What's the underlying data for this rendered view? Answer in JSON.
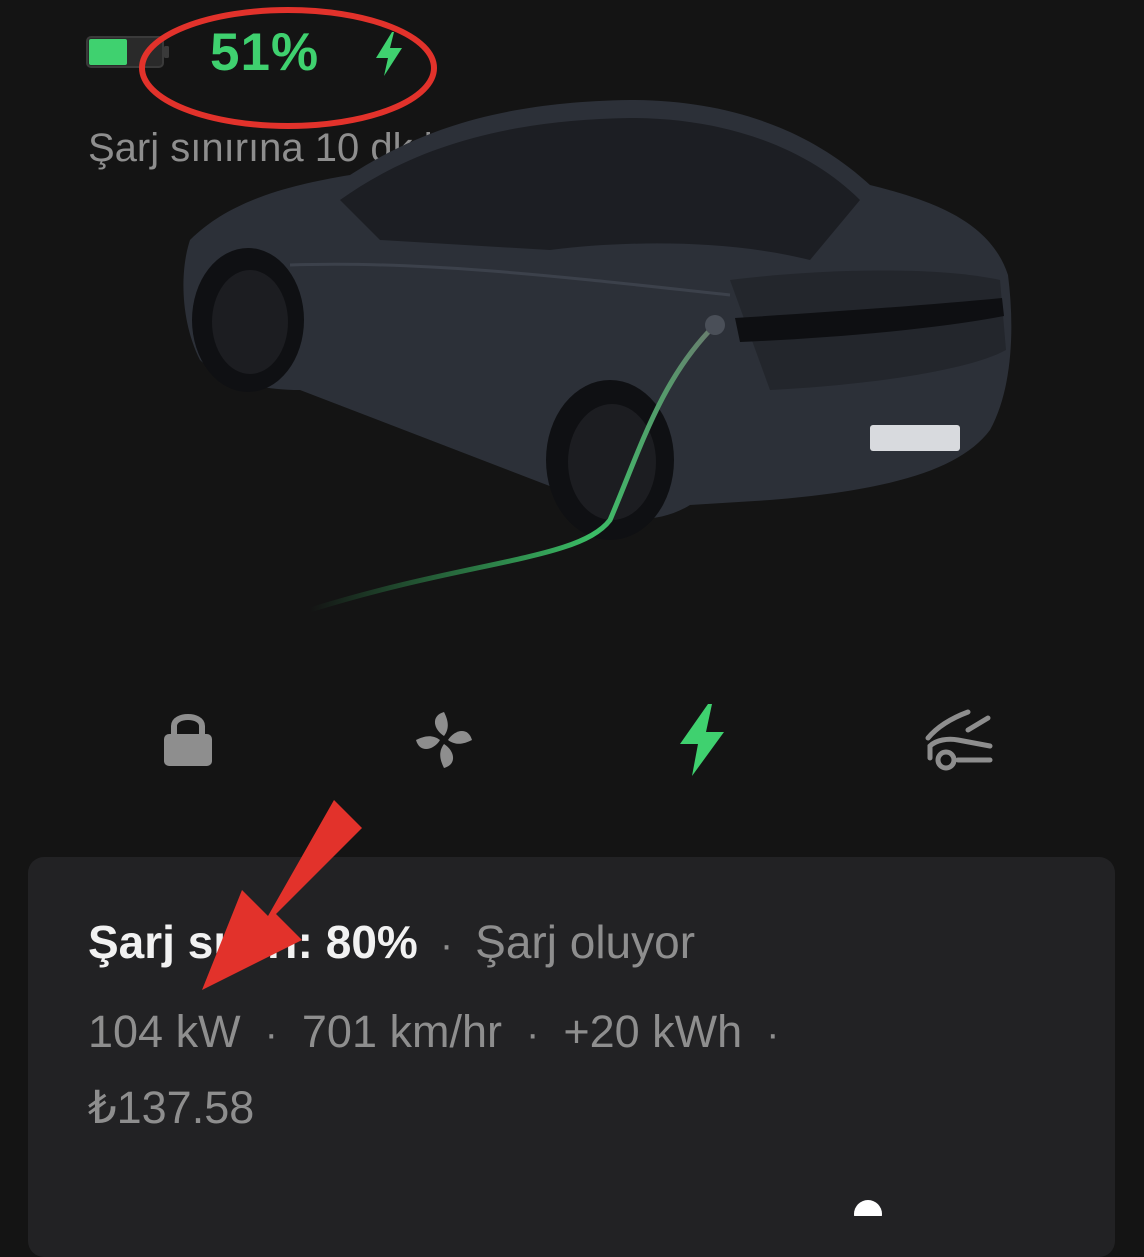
{
  "status": {
    "charge_percent": "51%",
    "battery_level": 0.51,
    "time_remaining": "Şarj sınırına 10 dk kaldı",
    "accent_color": "#3fd16f"
  },
  "controls": [
    {
      "icon": "lock-icon",
      "active": false
    },
    {
      "icon": "fan-icon",
      "active": false
    },
    {
      "icon": "lightning-icon",
      "active": true
    },
    {
      "icon": "frunk-icon",
      "active": false
    }
  ],
  "card": {
    "limit_label": "Şarj sınırı: 80%",
    "charging_status": "Şarj oluyor",
    "power": "104 kW",
    "rate": "701 km/hr",
    "energy_added": "+20 kWh",
    "cost": "₺137.58",
    "separator": "·"
  },
  "annotation_color": "#e2322b"
}
